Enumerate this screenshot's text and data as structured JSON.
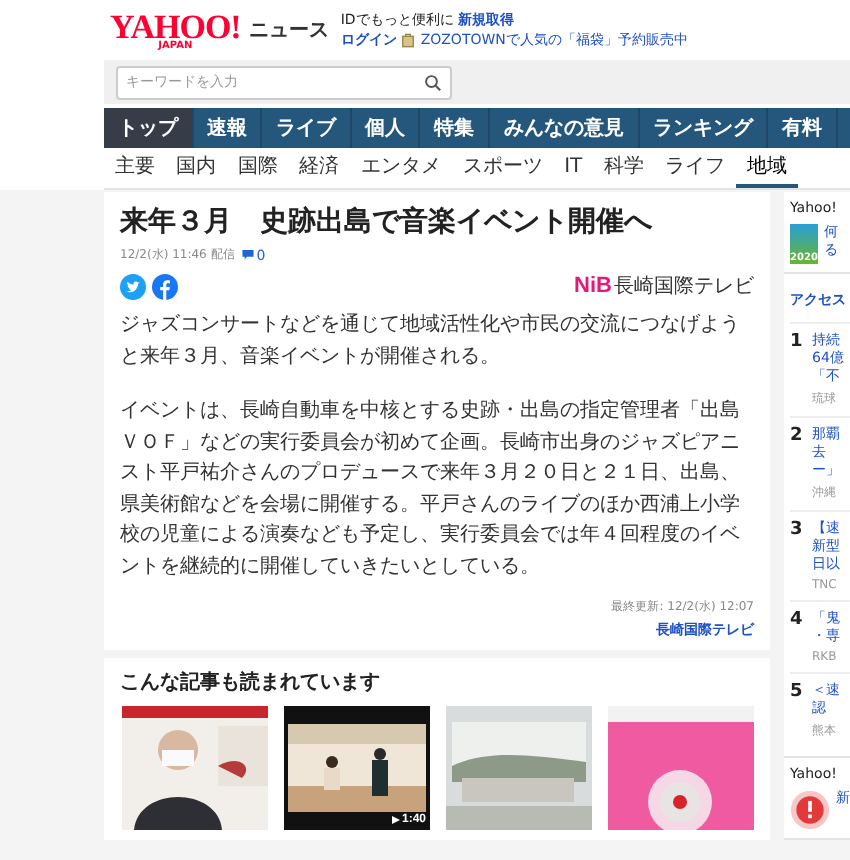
{
  "header": {
    "logo": "YAHOO!",
    "logo_sub": "JAPAN",
    "service": "ニュース",
    "promo": "IDでもっと便利に",
    "signup_link": "新規取得",
    "login_link": "ログイン",
    "ad_link": "ZOZOTOWNで人気の「福袋」予約販売中"
  },
  "search": {
    "placeholder": "キーワードを入力"
  },
  "nav": [
    {
      "label": "トップ",
      "selected": true
    },
    {
      "label": "速報",
      "selected": false
    },
    {
      "label": "ライブ",
      "selected": false
    },
    {
      "label": "個人",
      "selected": false
    },
    {
      "label": "特集",
      "selected": false
    },
    {
      "label": "みんなの意見",
      "selected": false
    },
    {
      "label": "ランキング",
      "selected": false
    },
    {
      "label": "有料",
      "selected": false
    }
  ],
  "subnav": [
    {
      "label": "主要",
      "selected": false
    },
    {
      "label": "国内",
      "selected": false
    },
    {
      "label": "国際",
      "selected": false
    },
    {
      "label": "経済",
      "selected": false
    },
    {
      "label": "エンタメ",
      "selected": false
    },
    {
      "label": "スポーツ",
      "selected": false
    },
    {
      "label": "IT",
      "selected": false
    },
    {
      "label": "科学",
      "selected": false
    },
    {
      "label": "ライフ",
      "selected": false
    },
    {
      "label": "地域",
      "selected": true
    }
  ],
  "article": {
    "title": "来年３月　史跡出島で音楽イベント開催へ",
    "date": "12/2(水) 11:46 配信",
    "comments": "0",
    "source_logo_mark": "NiB",
    "source_logo_name": "長崎国際テレビ",
    "paragraphs": [
      "ジャズコンサートなどを通じて地域活性化や市民の交流につなげようと来年３月、音楽イベントが開催される。",
      "イベントは、長崎自動車を中核とする史跡・出島の指定管理者「出島ＶＯＦ」などの実行委員会が初めて企画。長崎市出身のジャズピアニスト平戸祐介さんのプロデュースで来年３月２０日と２１日、出島、県美術館などを会場に開催する。平戸さんのライブのほか西浦上小学校の児童による演奏なども予定し、実行委員会では年４回程度のイベントを継続的に開催していきたいとしている。"
    ],
    "updated": "最終更新: 12/2(水) 12:07",
    "source_link": "長崎国際テレビ"
  },
  "related": {
    "heading": "こんな記事も読まれています",
    "items": [
      {
        "kind": "picture"
      },
      {
        "kind": "video",
        "duration": "1:40"
      },
      {
        "kind": "picture"
      },
      {
        "kind": "picture"
      }
    ]
  },
  "sidebar": {
    "heading": "Yahoo!",
    "banner_year": "2020",
    "banner_lines": [
      "何",
      "る"
    ],
    "ranking_heading": "アクセス",
    "ranking": [
      {
        "rank": "1",
        "lines": [
          "持続",
          "64億",
          "「不"
        ],
        "source": "琉球"
      },
      {
        "rank": "2",
        "lines": [
          "那覇",
          "去",
          "ー」"
        ],
        "source": "沖縄"
      },
      {
        "rank": "3",
        "lines": [
          "【速",
          "新型",
          "日以"
        ],
        "source": "TNC"
      },
      {
        "rank": "4",
        "lines": [
          "「鬼",
          "・専"
        ],
        "source": "RKB"
      },
      {
        "rank": "5",
        "lines": [
          "＜速",
          "認"
        ],
        "source": "熊本"
      }
    ],
    "heading2": "Yahoo!",
    "alert_text": "新"
  }
}
